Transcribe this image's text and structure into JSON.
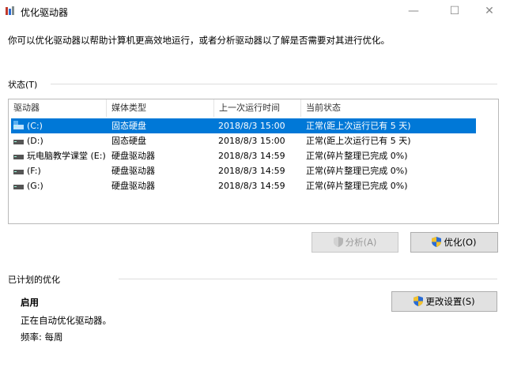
{
  "window": {
    "title": "优化驱动器",
    "minimize_glyph": "—",
    "maximize_glyph": "☐",
    "close_glyph": "✕"
  },
  "description": "你可以优化驱动器以帮助计算机更高效地运行，或者分析驱动器以了解是否需要对其进行优化。",
  "status_section": {
    "label": "状态(T)",
    "columns": [
      "驱动器",
      "媒体类型",
      "上一次运行时间",
      "当前状态"
    ],
    "rows": [
      {
        "drive": "(C:)",
        "media": "固态硬盘",
        "last_run": "2018/8/3 15:00",
        "status": "正常(距上次运行已有 5 天)",
        "selected": true,
        "system": true
      },
      {
        "drive": "(D:)",
        "media": "固态硬盘",
        "last_run": "2018/8/3 15:00",
        "status": "正常(距上次运行已有 5 天)",
        "selected": false,
        "system": false
      },
      {
        "drive": "玩电脑教学课堂 (E:)",
        "media": "硬盘驱动器",
        "last_run": "2018/8/3 14:59",
        "status": "正常(碎片整理已完成 0%)",
        "selected": false,
        "system": false
      },
      {
        "drive": "(F:)",
        "media": "硬盘驱动器",
        "last_run": "2018/8/3 14:59",
        "status": "正常(碎片整理已完成 0%)",
        "selected": false,
        "system": false
      },
      {
        "drive": "(G:)",
        "media": "硬盘驱动器",
        "last_run": "2018/8/3 14:59",
        "status": "正常(碎片整理已完成 0%)",
        "selected": false,
        "system": false
      }
    ],
    "analyze_label": "分析(A)",
    "optimize_label": "优化(O)"
  },
  "schedule_section": {
    "label": "已计划的优化",
    "state": "启用",
    "status_text": "正在自动优化驱动器。",
    "frequency": "频率: 每周",
    "change_label": "更改设置(S)"
  },
  "colors": {
    "selection": "#0078d7",
    "shield_blue": "#2b6cd4",
    "shield_yellow": "#f2c12e"
  }
}
